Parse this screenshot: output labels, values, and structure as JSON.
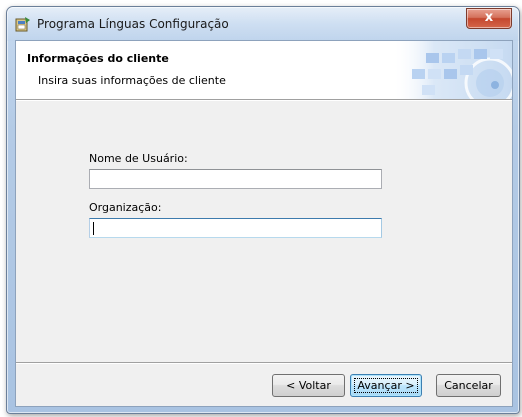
{
  "window": {
    "title": "Programa Línguas Configuração",
    "close_symbol": "x",
    "icons": {
      "app": "installer-icon",
      "close": "close-icon"
    },
    "accent_color": "#3c7fb1"
  },
  "banner": {
    "title": "Informações do cliente",
    "subtitle": "Insira suas informações de cliente"
  },
  "form": {
    "username_label": "Nome de Usuário:",
    "username_value": "",
    "organization_label": "Organização:",
    "organization_value": ""
  },
  "buttons": {
    "back": "< Voltar",
    "next": "Avançar >",
    "cancel": "Cancelar"
  }
}
